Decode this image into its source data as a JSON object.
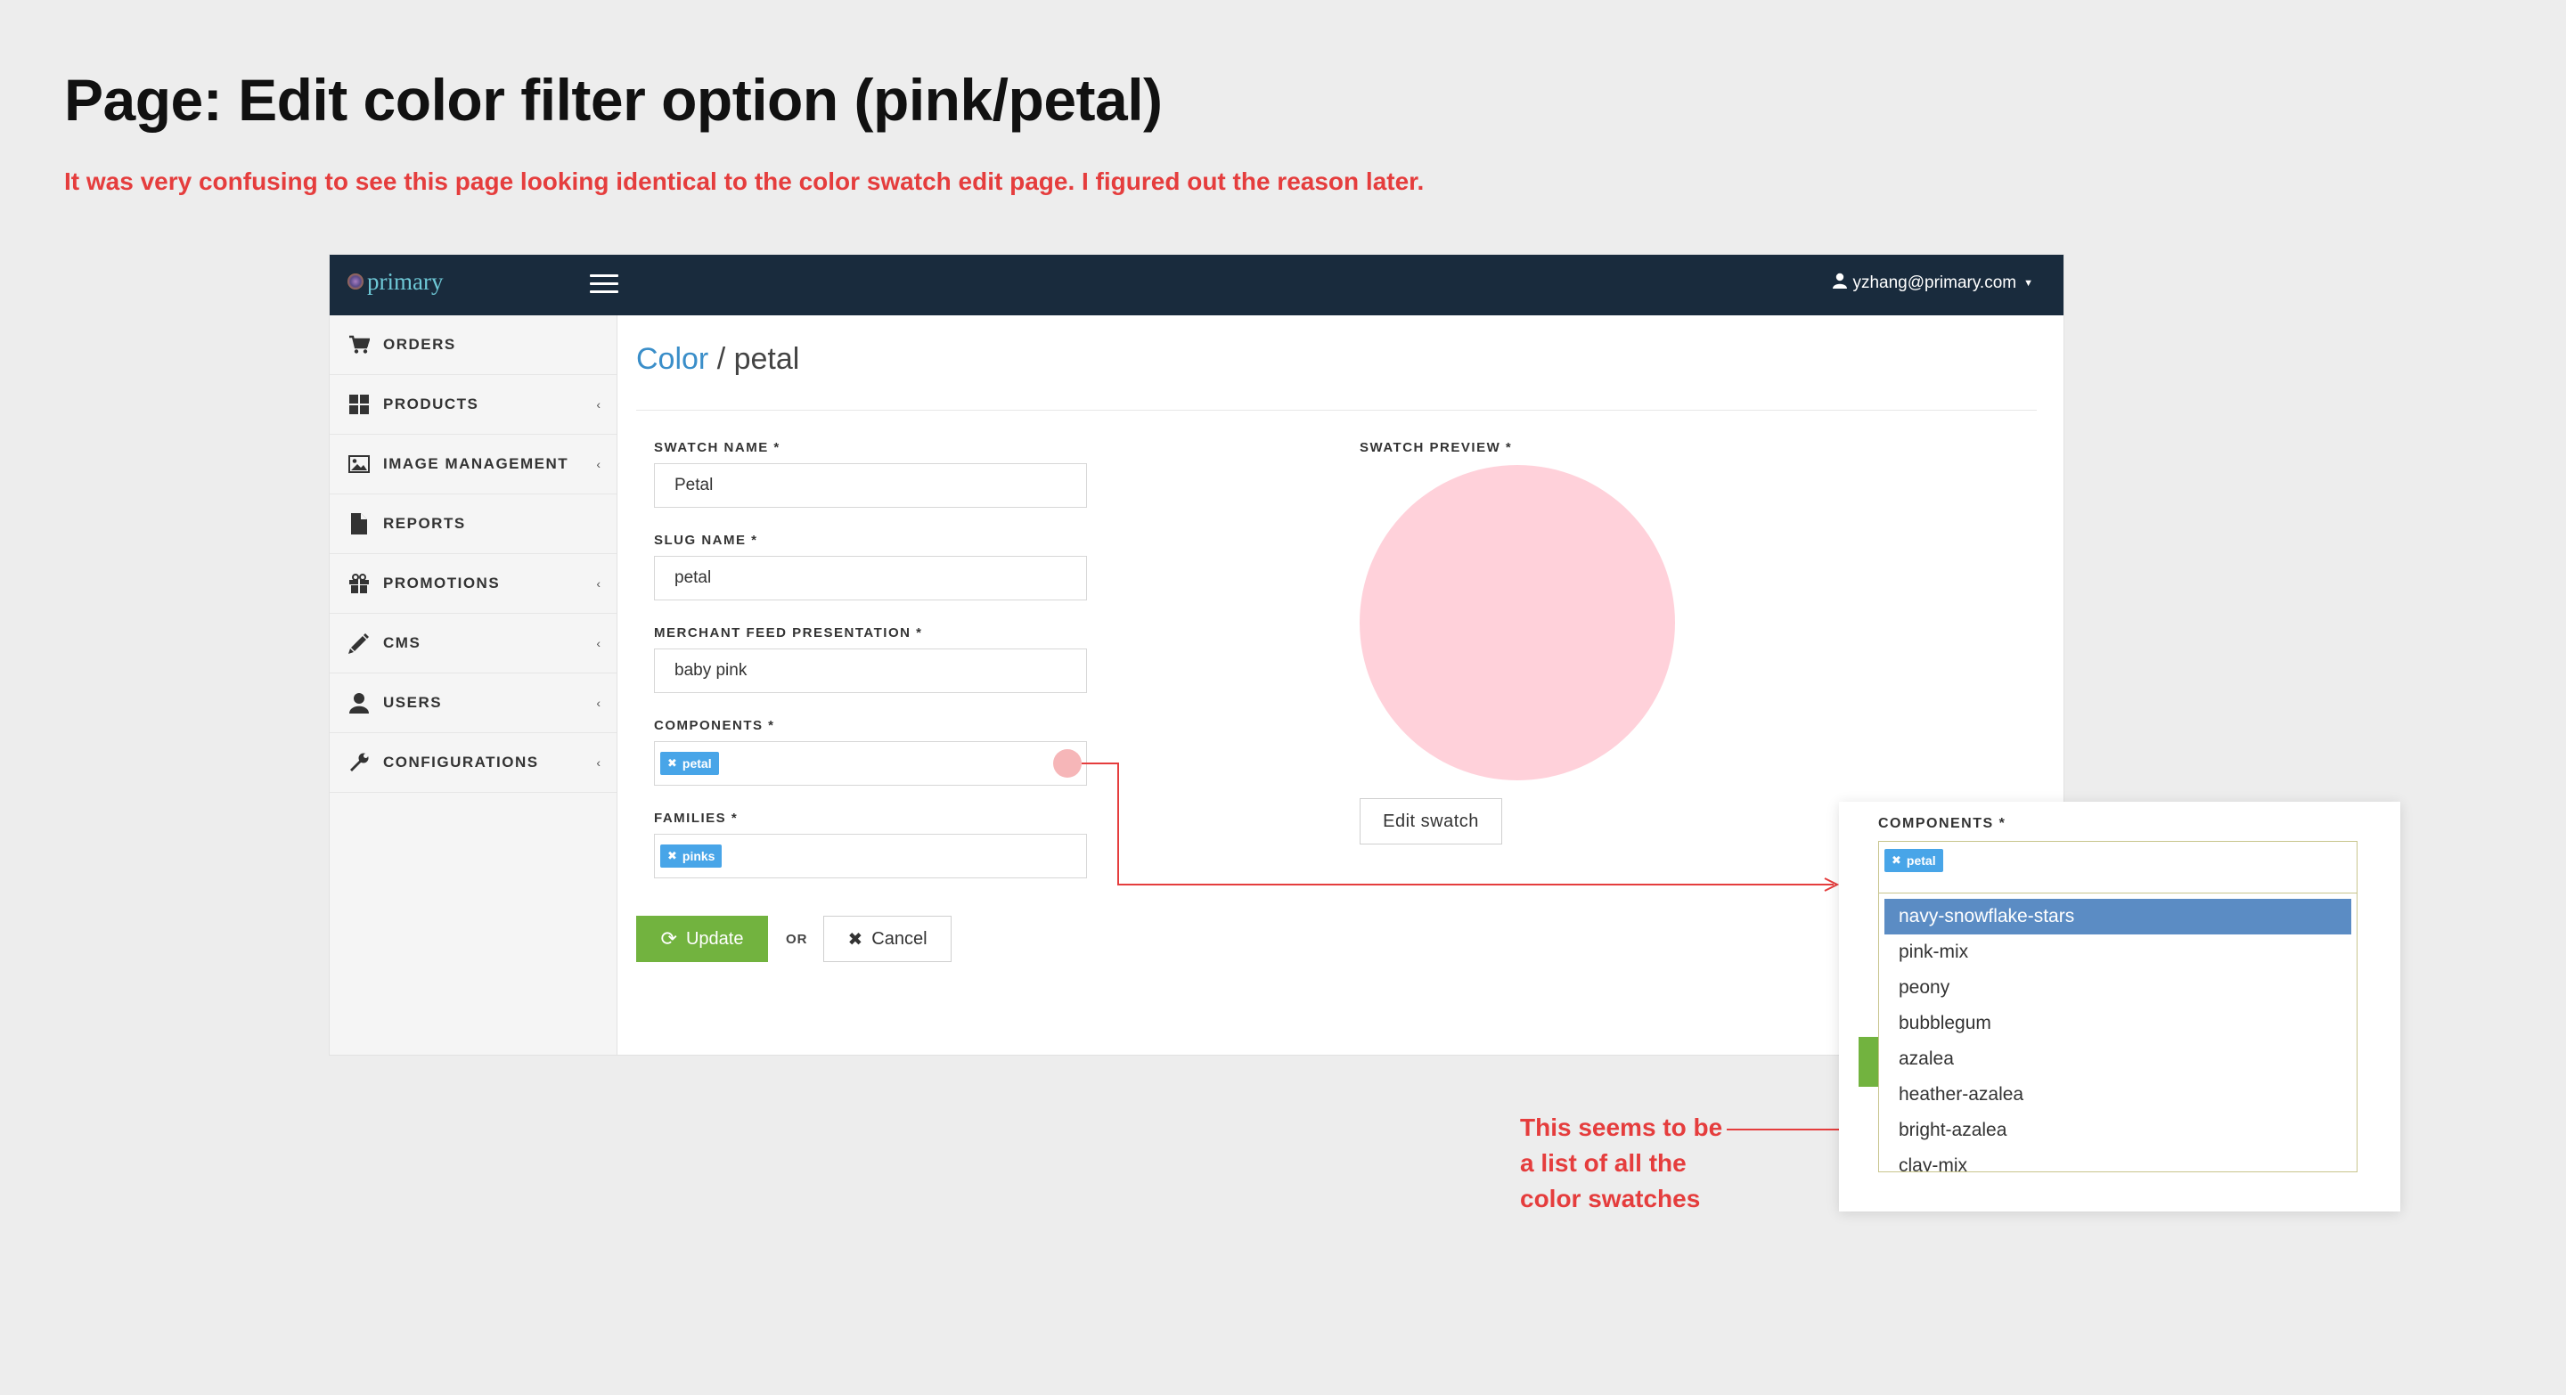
{
  "page": {
    "title": "Page: Edit color filter option (pink/petal)",
    "note_top": "It was very confusing to see this page looking identical to the color swatch edit page. I figured out the reason later.",
    "note_bottom": "This seems to be a list of all the color swatches"
  },
  "topbar": {
    "logo_text": "primary",
    "user_email": "yzhang@primary.com"
  },
  "sidebar": {
    "items": [
      {
        "label": "ORDERS",
        "icon": "cart-icon",
        "has_caret": false
      },
      {
        "label": "PRODUCTS",
        "icon": "grid-icon",
        "has_caret": true
      },
      {
        "label": "IMAGE MANAGEMENT",
        "icon": "image-icon",
        "has_caret": true
      },
      {
        "label": "REPORTS",
        "icon": "file-icon",
        "has_caret": false
      },
      {
        "label": "PROMOTIONS",
        "icon": "gift-icon",
        "has_caret": true
      },
      {
        "label": "CMS",
        "icon": "pencil-icon",
        "has_caret": true
      },
      {
        "label": "USERS",
        "icon": "user-icon",
        "has_caret": true
      },
      {
        "label": "CONFIGURATIONS",
        "icon": "wrench-icon",
        "has_caret": true
      }
    ]
  },
  "breadcrumb": {
    "parent": "Color",
    "separator": "/",
    "current": "petal"
  },
  "form": {
    "swatch_name": {
      "label": "SWATCH NAME *",
      "value": "Petal"
    },
    "slug_name": {
      "label": "SLUG NAME *",
      "value": "petal"
    },
    "merchant_feed": {
      "label": "MERCHANT FEED PRESENTATION *",
      "value": "baby pink"
    },
    "components": {
      "label": "COMPONENTS *",
      "tags": [
        "petal"
      ]
    },
    "families": {
      "label": "FAMILIES *",
      "tags": [
        "pinks"
      ]
    },
    "update_label": "Update",
    "or_label": "OR",
    "cancel_label": "Cancel"
  },
  "swatch_preview": {
    "label": "SWATCH PREVIEW *",
    "color": "#ffd1da",
    "edit_label": "Edit swatch"
  },
  "popup": {
    "label": "COMPONENTS *",
    "tag": "petal",
    "options": [
      "navy-snowflake-stars",
      "pink-mix",
      "peony",
      "bubblegum",
      "azalea",
      "heather-azalea",
      "bright-azalea",
      "clay-mix"
    ],
    "selected_index": 0
  },
  "colors": {
    "topbar": "#192b3d",
    "accent_blue": "#3a8ec9",
    "tag_blue": "#48a5e8",
    "update_green": "#72b33f",
    "annotation_red": "#e53d3d",
    "dropdown_selected": "#5b8cc4"
  }
}
